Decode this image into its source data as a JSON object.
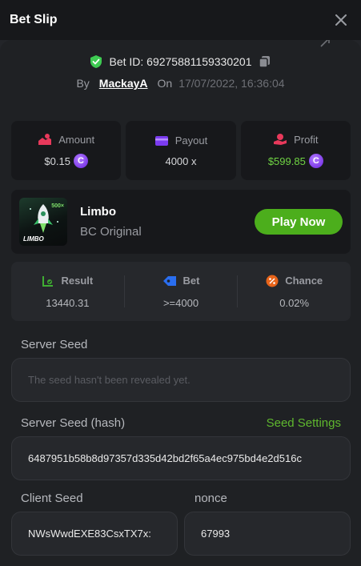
{
  "header": {
    "title": "Bet Slip"
  },
  "bet": {
    "id_label": "Bet ID: 69275881159330201",
    "by_label": "By",
    "user": "MackayA",
    "on_label": "On",
    "date": "17/07/2022, 16:36:04"
  },
  "stats": {
    "amount_label": "Amount",
    "amount_value": "$0.15",
    "payout_label": "Payout",
    "payout_value": "4000 x",
    "profit_label": "Profit",
    "profit_value": "$599.85",
    "coin_symbol": "C"
  },
  "game": {
    "name": "Limbo",
    "subtitle": "BC Original",
    "thumb_text": "LIMBO",
    "thumb_multiplier": "500×",
    "play_label": "Play Now"
  },
  "result": {
    "result_label": "Result",
    "result_value": "13440.31",
    "bet_label": "Bet",
    "bet_value": ">=4000",
    "chance_label": "Chance",
    "chance_value": "0.02%"
  },
  "seeds": {
    "server_seed_label": "Server Seed",
    "server_seed_placeholder": "The seed hasn't been revealed yet.",
    "server_hash_label": "Server Seed (hash)",
    "seed_settings_label": "Seed Settings",
    "server_hash_value": "6487951b58b8d97357d335d42bd2f65a4ec975bd4e2d516c",
    "client_seed_label": "Client Seed",
    "client_seed_value": "NWsWwdEXE83CsxTX7x:",
    "nonce_label": "nonce",
    "nonce_value": "67993"
  },
  "colors": {
    "accent_green": "#4cae1c",
    "profit_green": "#6fd343",
    "coin_purple": "#7b3bf0",
    "shield_green": "#3ecb52"
  }
}
